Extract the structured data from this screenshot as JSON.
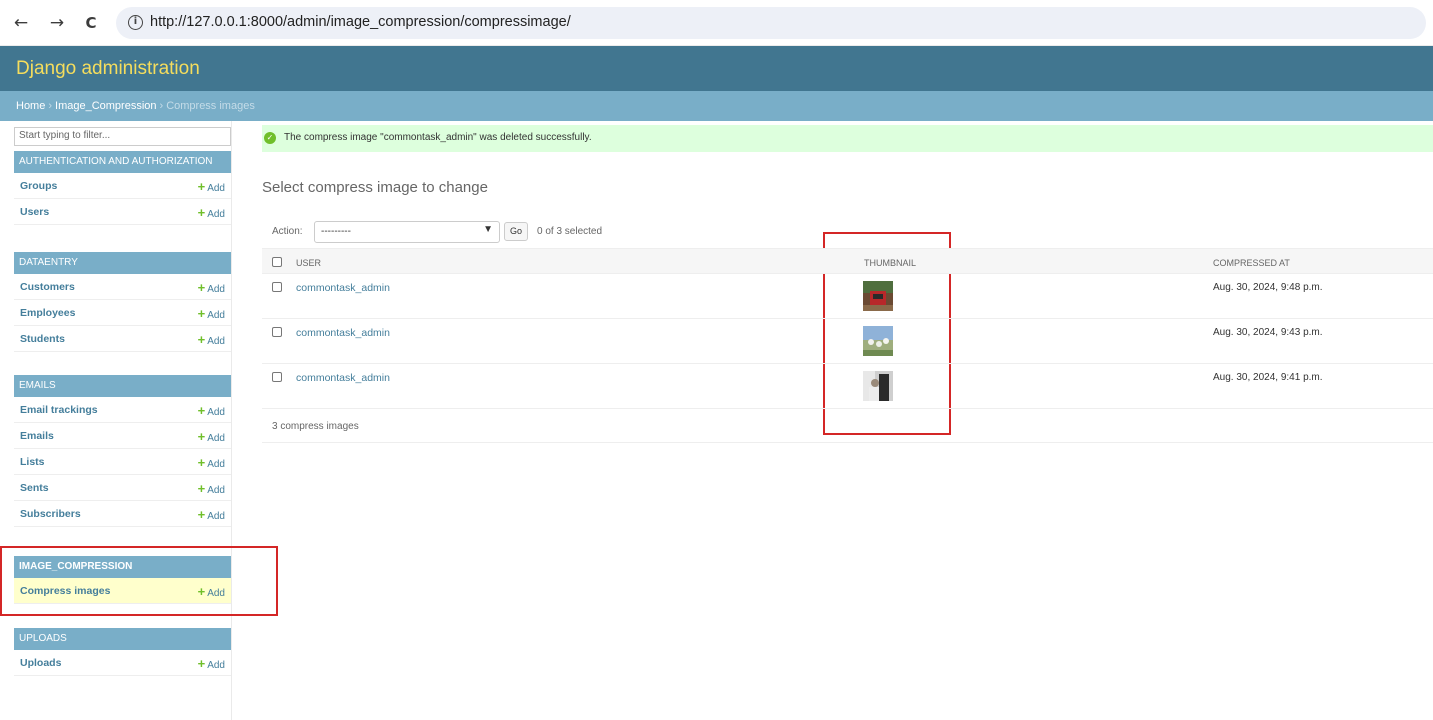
{
  "browser": {
    "back": "←",
    "forward": "→",
    "reload": "C",
    "url": "http://127.0.0.1:8000/admin/image_compression/compressimage/"
  },
  "header": {
    "brand": "Django administration"
  },
  "breadcrumbs": {
    "home": "Home",
    "app": "Image_Compression",
    "current": "Compress images",
    "separator": "›"
  },
  "sidebar": {
    "filter_placeholder": "Start typing to filter...",
    "add_label": "Add",
    "apps": [
      {
        "name": "AUTHENTICATION AND AUTHORIZATION",
        "models": [
          "Groups",
          "Users"
        ]
      },
      {
        "name": "DATAENTRY",
        "models": [
          "Customers",
          "Employees",
          "Students"
        ]
      },
      {
        "name": "EMAILS",
        "models": [
          "Email trackings",
          "Emails",
          "Lists",
          "Sents",
          "Subscribers"
        ]
      },
      {
        "name": "IMAGE_COMPRESSION",
        "models": [
          "Compress images"
        ]
      },
      {
        "name": "UPLOADS",
        "models": [
          "Uploads"
        ]
      }
    ]
  },
  "messages": {
    "success": "The compress image \"commontask_admin\" was deleted successfully."
  },
  "content": {
    "title": "Select compress image to change",
    "action_label": "Action:",
    "action_value": "---------",
    "go_label": "Go",
    "selected_count": "0 of 3 selected",
    "columns": [
      "USER",
      "THUMBNAIL",
      "COMPRESSED AT"
    ],
    "rows": [
      {
        "user": "commontask_admin",
        "date": "Aug. 30, 2024, 9:48 p.m."
      },
      {
        "user": "commontask_admin",
        "date": "Aug. 30, 2024, 9:43 p.m."
      },
      {
        "user": "commontask_admin",
        "date": "Aug. 30, 2024, 9:41 p.m."
      }
    ],
    "paginator": "3 compress images"
  },
  "colors": {
    "header": "#417690",
    "breadcrumbs": "#79aec8",
    "brand": "#f5dd5d",
    "success_bg": "#ddffdd",
    "highlight_box": "#d42626"
  }
}
